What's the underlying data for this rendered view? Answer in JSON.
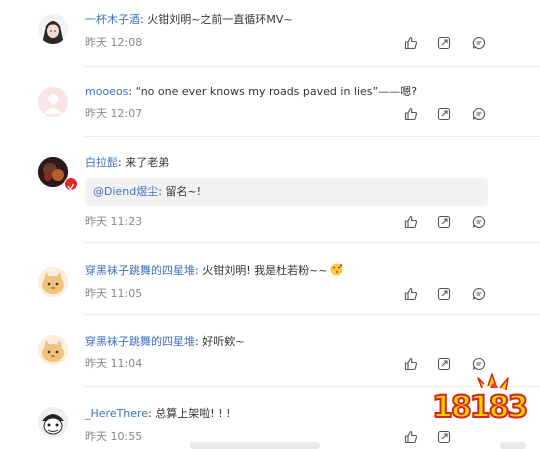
{
  "comments": [
    {
      "user": "一杯木子酒",
      "text": ": 火钳刘明~之前一直循环MV~",
      "time": "昨天 12:08"
    },
    {
      "user": "mooeos",
      "text": ": “no one ever knows my roads paved in lies”——嗯?",
      "time": "昨天 12:07"
    },
    {
      "user": "白拉髭",
      "text": ": 来了老弟",
      "quote_user": "@Diend煜尘",
      "quote_text": ": 留名~!",
      "time": "昨天 11:23"
    },
    {
      "user": "穿黑袜子跳舞的四星堆",
      "text": ": 火钳刘明! 我是杜若粉~~",
      "time": "昨天 11:05"
    },
    {
      "user": "穿黑袜子跳舞的四星堆",
      "text": ": 好听欸~",
      "time": "昨天 11:04"
    },
    {
      "user": "_HereThere",
      "text": ": 总算上架啦! ! !",
      "time": "昨天 10:55"
    }
  ],
  "icons": [
    "like-icon",
    "share-icon",
    "comment-icon",
    "verified-badge-icon"
  ],
  "colors": {
    "username": "#3f6fbf",
    "text": "#333333",
    "time": "#888888",
    "quote_bg": "#f2f2f2",
    "logo_yellow": "#ffcf00",
    "logo_red": "#d4261c"
  },
  "watermark": "18183"
}
